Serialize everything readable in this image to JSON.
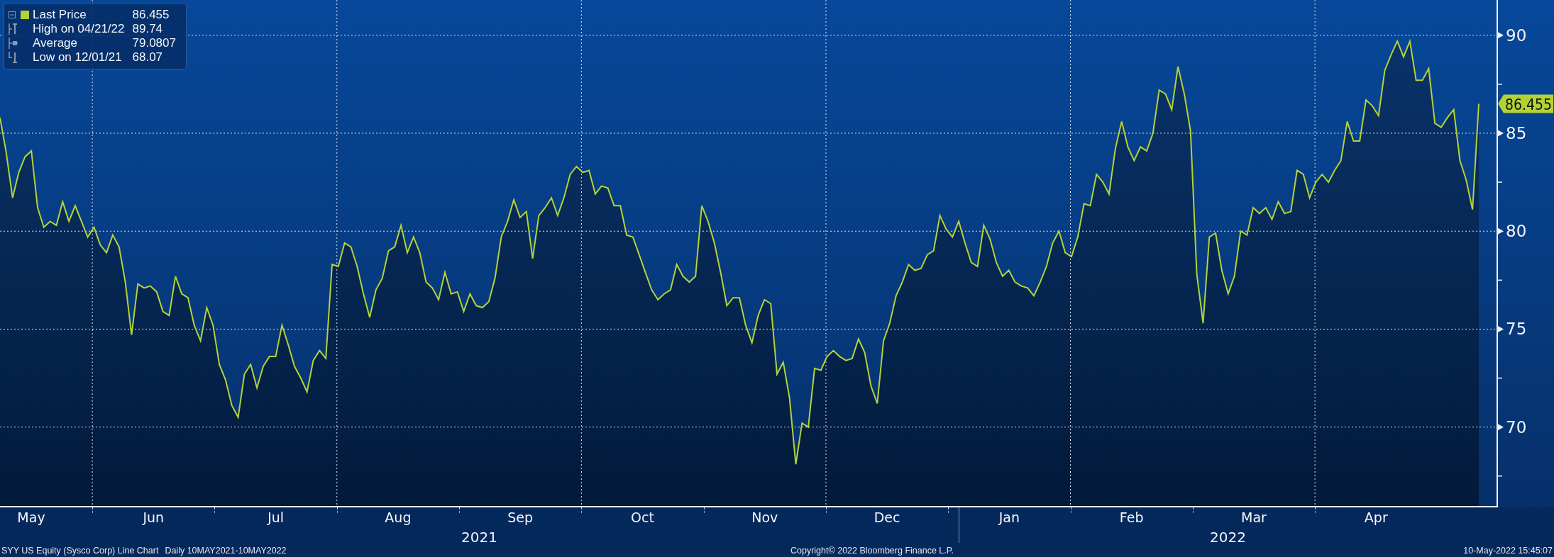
{
  "chart": {
    "legend": [
      {
        "kind": "last",
        "label": "Last Price",
        "value": "86.455"
      },
      {
        "kind": "high",
        "label": "High on 04/21/22",
        "value": "89.74"
      },
      {
        "kind": "average",
        "label": "Average",
        "value": "79.0807"
      },
      {
        "kind": "low",
        "label": "Low on 12/01/21",
        "value": "68.07"
      }
    ],
    "last_price_tag": "86.455",
    "months": [
      "May",
      "Jun",
      "Jul",
      "Aug",
      "Sep",
      "Oct",
      "Nov",
      "Dec",
      "Jan",
      "Feb",
      "Mar",
      "Apr"
    ],
    "years": [
      "2021",
      "2022"
    ],
    "chart_data": {
      "type": "area",
      "grid": true,
      "ylim": [
        65.9,
        91.8
      ],
      "yticks": [
        70,
        75,
        80,
        85,
        90
      ],
      "series": [
        {
          "color": "#b4d236",
          "values": [
            85.8,
            84.0,
            81.7,
            83.0,
            83.8,
            84.1,
            81.2,
            80.2,
            80.5,
            80.3,
            81.5,
            80.5,
            81.3,
            80.5,
            79.7,
            80.2,
            79.3,
            78.9,
            79.8,
            79.2,
            77.4,
            74.7,
            77.3,
            77.1,
            77.2,
            76.9,
            75.9,
            75.7,
            77.7,
            76.8,
            76.6,
            75.2,
            74.4,
            76.1,
            75.2,
            73.2,
            72.4,
            71.1,
            70.5,
            72.7,
            73.2,
            72.0,
            73.1,
            73.6,
            73.6,
            75.2,
            74.2,
            73.1,
            72.5,
            71.8,
            73.4,
            73.9,
            73.5,
            78.3,
            78.2,
            79.4,
            79.2,
            78.2,
            76.8,
            75.6,
            77.0,
            77.6,
            79.0,
            79.2,
            80.3,
            78.9,
            79.7,
            78.9,
            77.4,
            77.1,
            76.5,
            77.9,
            76.8,
            76.9,
            75.9,
            76.8,
            76.2,
            76.1,
            76.4,
            77.6,
            79.7,
            80.5,
            81.6,
            80.7,
            81.0,
            78.6,
            80.8,
            81.2,
            81.7,
            80.8,
            81.7,
            82.9,
            83.3,
            83.0,
            83.1,
            81.9,
            82.3,
            82.2,
            81.3,
            81.3,
            79.8,
            79.7,
            78.8,
            77.9,
            77.0,
            76.5,
            76.8,
            77.0,
            78.3,
            77.7,
            77.4,
            77.7,
            81.3,
            80.5,
            79.4,
            77.9,
            76.2,
            76.6,
            76.6,
            75.2,
            74.3,
            75.7,
            76.5,
            76.3,
            72.7,
            73.3,
            71.5,
            68.1,
            70.2,
            70.0,
            73.0,
            72.9,
            73.6,
            73.9,
            73.6,
            73.4,
            73.5,
            74.5,
            73.8,
            72.1,
            71.2,
            74.4,
            75.3,
            76.7,
            77.4,
            78.3,
            78.0,
            78.1,
            78.8,
            79.0,
            80.8,
            80.1,
            79.7,
            80.5,
            79.4,
            78.4,
            78.2,
            80.3,
            79.6,
            78.4,
            77.7,
            78.0,
            77.4,
            77.2,
            77.1,
            76.7,
            77.4,
            78.2,
            79.4,
            80.0,
            78.9,
            78.7,
            79.7,
            81.4,
            81.3,
            82.9,
            82.5,
            81.9,
            84.2,
            85.6,
            84.3,
            83.6,
            84.3,
            84.1,
            85.0,
            87.2,
            87.0,
            86.2,
            88.4,
            87.0,
            85.1,
            77.8,
            75.3,
            79.7,
            79.9,
            78.0,
            76.8,
            77.7,
            80.0,
            79.8,
            81.2,
            80.9,
            81.2,
            80.6,
            81.5,
            80.9,
            81.0,
            83.1,
            82.9,
            81.7,
            82.5,
            82.9,
            82.5,
            83.1,
            83.6,
            85.6,
            84.6,
            84.6,
            86.7,
            86.4,
            85.9,
            88.2,
            89.0,
            89.7,
            88.9,
            89.7,
            87.7,
            87.7,
            88.3,
            85.5,
            85.3,
            85.8,
            86.2,
            83.6,
            82.6,
            81.1,
            86.5
          ]
        }
      ]
    }
  },
  "footer": {
    "title": "SYY US Equity (Sysco Corp) Line Chart",
    "range": "Daily 10MAY2021-10MAY2022",
    "copyright": "Copyright© 2022 Bloomberg Finance L.P.",
    "timestamp": "10-May-2022 15:45:07"
  }
}
